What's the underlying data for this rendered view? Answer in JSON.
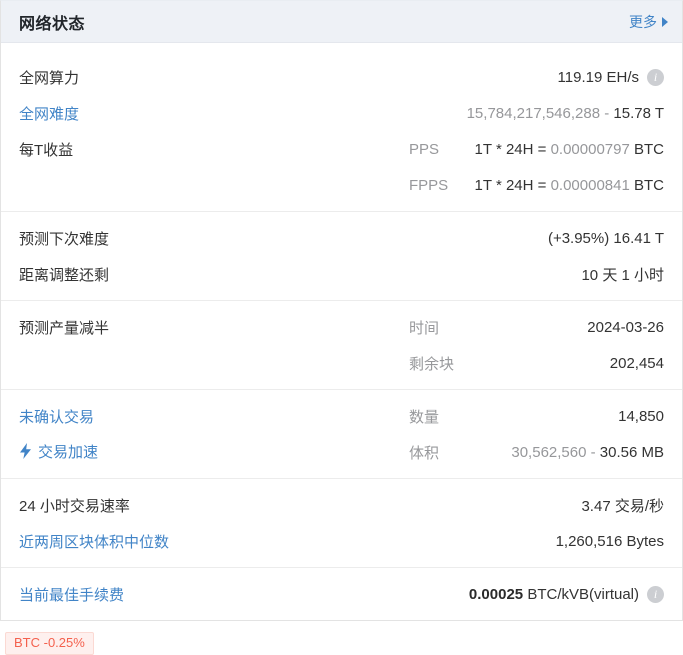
{
  "header": {
    "title": "网络状态",
    "more_label": "更多"
  },
  "icons": {
    "more_arrow": "right-triangle",
    "info": "i-circle",
    "lightning": "lightning-bolt"
  },
  "colors": {
    "link_blue": "#4184c7",
    "text_dark": "#333333",
    "text_gray": "#96979a",
    "header_bg": "#eef1f6",
    "badge_red": "#f4614e",
    "badge_bg": "#fef0ee"
  },
  "card": {
    "sections": [
      {
        "rows": [
          {
            "key": "network-hashrate",
            "label": "全网算力",
            "link": false,
            "info": true,
            "value": [
              {
                "t": "119.19 EH/s",
                "c": "dark"
              }
            ]
          },
          {
            "key": "network-difficulty",
            "label": "全网难度",
            "link": true,
            "value": [
              {
                "t": "15,784,217,546,288 - ",
                "c": "gray"
              },
              {
                "t": "15.78 T",
                "c": "dark"
              }
            ]
          },
          {
            "key": "earnings-per-t-pps",
            "label": "每T收益",
            "link": false,
            "mid": "PPS",
            "value": [
              {
                "t": "1T * 24H = ",
                "c": "dark"
              },
              {
                "t": "0.00000797",
                "c": "gray"
              },
              {
                "t": " BTC",
                "c": "dark"
              }
            ]
          },
          {
            "key": "earnings-per-t-fpps",
            "label": "",
            "mid": "FPPS",
            "value": [
              {
                "t": "1T * 24H = ",
                "c": "dark"
              },
              {
                "t": "0.00000841",
                "c": "gray"
              },
              {
                "t": " BTC",
                "c": "dark"
              }
            ]
          }
        ]
      },
      {
        "rows": [
          {
            "key": "predicted-next-difficulty",
            "label": "预测下次难度",
            "link": false,
            "value": [
              {
                "t": "(+3.95%) 16.41 T",
                "c": "dark"
              }
            ]
          },
          {
            "key": "time-to-adjustment",
            "label": "距离调整还剩",
            "link": false,
            "value": [
              {
                "t": "10 天 1 小时",
                "c": "dark"
              }
            ]
          }
        ]
      },
      {
        "rows": [
          {
            "key": "predicted-halving-time",
            "label": "预测产量减半",
            "link": false,
            "mid": "时间",
            "value": [
              {
                "t": "2024-03-26",
                "c": "dark"
              }
            ]
          },
          {
            "key": "predicted-halving-blocks",
            "label": "",
            "mid": "剩余块",
            "value": [
              {
                "t": "202,454",
                "c": "dark"
              }
            ]
          }
        ]
      },
      {
        "rows": [
          {
            "key": "unconfirmed-transactions",
            "label": "未确认交易",
            "link": true,
            "mid": "数量",
            "value": [
              {
                "t": "14,850",
                "c": "dark"
              }
            ]
          },
          {
            "key": "transaction-acceleration",
            "label": "交易加速",
            "link": true,
            "bolt": true,
            "mid": "体积",
            "value": [
              {
                "t": "30,562,560 - ",
                "c": "gray"
              },
              {
                "t": "30.56 MB",
                "c": "dark"
              }
            ]
          }
        ]
      },
      {
        "rows": [
          {
            "key": "tx-rate-24h",
            "label": "24 小时交易速率",
            "link": false,
            "value": [
              {
                "t": "3.47 交易/秒",
                "c": "dark"
              }
            ]
          },
          {
            "key": "median-block-size-2w",
            "label": "近两周区块体积中位数",
            "link": true,
            "value": [
              {
                "t": "1,260,516 Bytes",
                "c": "dark"
              }
            ]
          }
        ]
      },
      {
        "rows": [
          {
            "key": "current-best-fee",
            "label": "当前最佳手续费",
            "link": true,
            "info": true,
            "value": [
              {
                "t": "0.00025 ",
                "c": "bold"
              },
              {
                "t": "BTC/kVB(virtual)",
                "c": "dark"
              }
            ]
          }
        ]
      }
    ]
  },
  "footer_badge": {
    "text": "BTC -0.25%"
  }
}
